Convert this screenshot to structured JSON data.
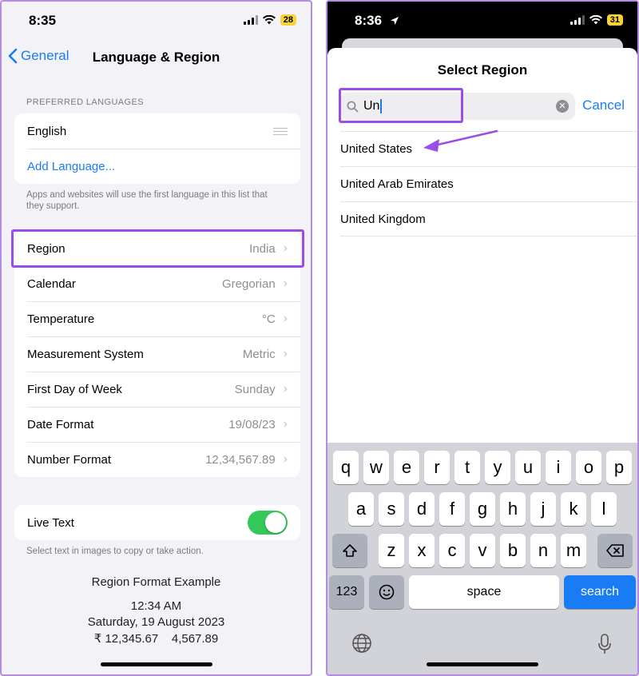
{
  "left": {
    "status": {
      "time": "8:35",
      "battery": "28"
    },
    "nav": {
      "back": "General",
      "title": "Language & Region"
    },
    "preferred_header": "PREFERRED LANGUAGES",
    "languages": [
      "English"
    ],
    "add_language": "Add Language...",
    "languages_footnote": "Apps and websites will use the first language in this list that they support.",
    "settings": [
      {
        "label": "Region",
        "value": "India"
      },
      {
        "label": "Calendar",
        "value": "Gregorian"
      },
      {
        "label": "Temperature",
        "value": "°C"
      },
      {
        "label": "Measurement System",
        "value": "Metric"
      },
      {
        "label": "First Day of Week",
        "value": "Sunday"
      },
      {
        "label": "Date Format",
        "value": "19/08/23"
      },
      {
        "label": "Number Format",
        "value": "12,34,567.89"
      }
    ],
    "live_text": {
      "label": "Live Text",
      "enabled": true
    },
    "live_text_footnote": "Select text in images to copy or take action.",
    "example": {
      "title": "Region Format Example",
      "time": "12:34 AM",
      "date": "Saturday, 19 August 2023",
      "numbers": "₹ 12,345.67    4,567.89"
    }
  },
  "right": {
    "status": {
      "time": "8:36",
      "battery": "31"
    },
    "sheet_title": "Select Region",
    "search": {
      "value": "Un"
    },
    "cancel": "Cancel",
    "results": [
      "United States",
      "United Arab Emirates",
      "United Kingdom"
    ],
    "keyboard": {
      "row1": [
        "q",
        "w",
        "e",
        "r",
        "t",
        "y",
        "u",
        "i",
        "o",
        "p"
      ],
      "row2": [
        "a",
        "s",
        "d",
        "f",
        "g",
        "h",
        "j",
        "k",
        "l"
      ],
      "row3": [
        "z",
        "x",
        "c",
        "v",
        "b",
        "n",
        "m"
      ],
      "numbers": "123",
      "space": "space",
      "search": "search"
    }
  },
  "colors": {
    "accent": "#1a7cf5",
    "highlight": "#9b4de8",
    "toggle_on": "#34c759"
  }
}
